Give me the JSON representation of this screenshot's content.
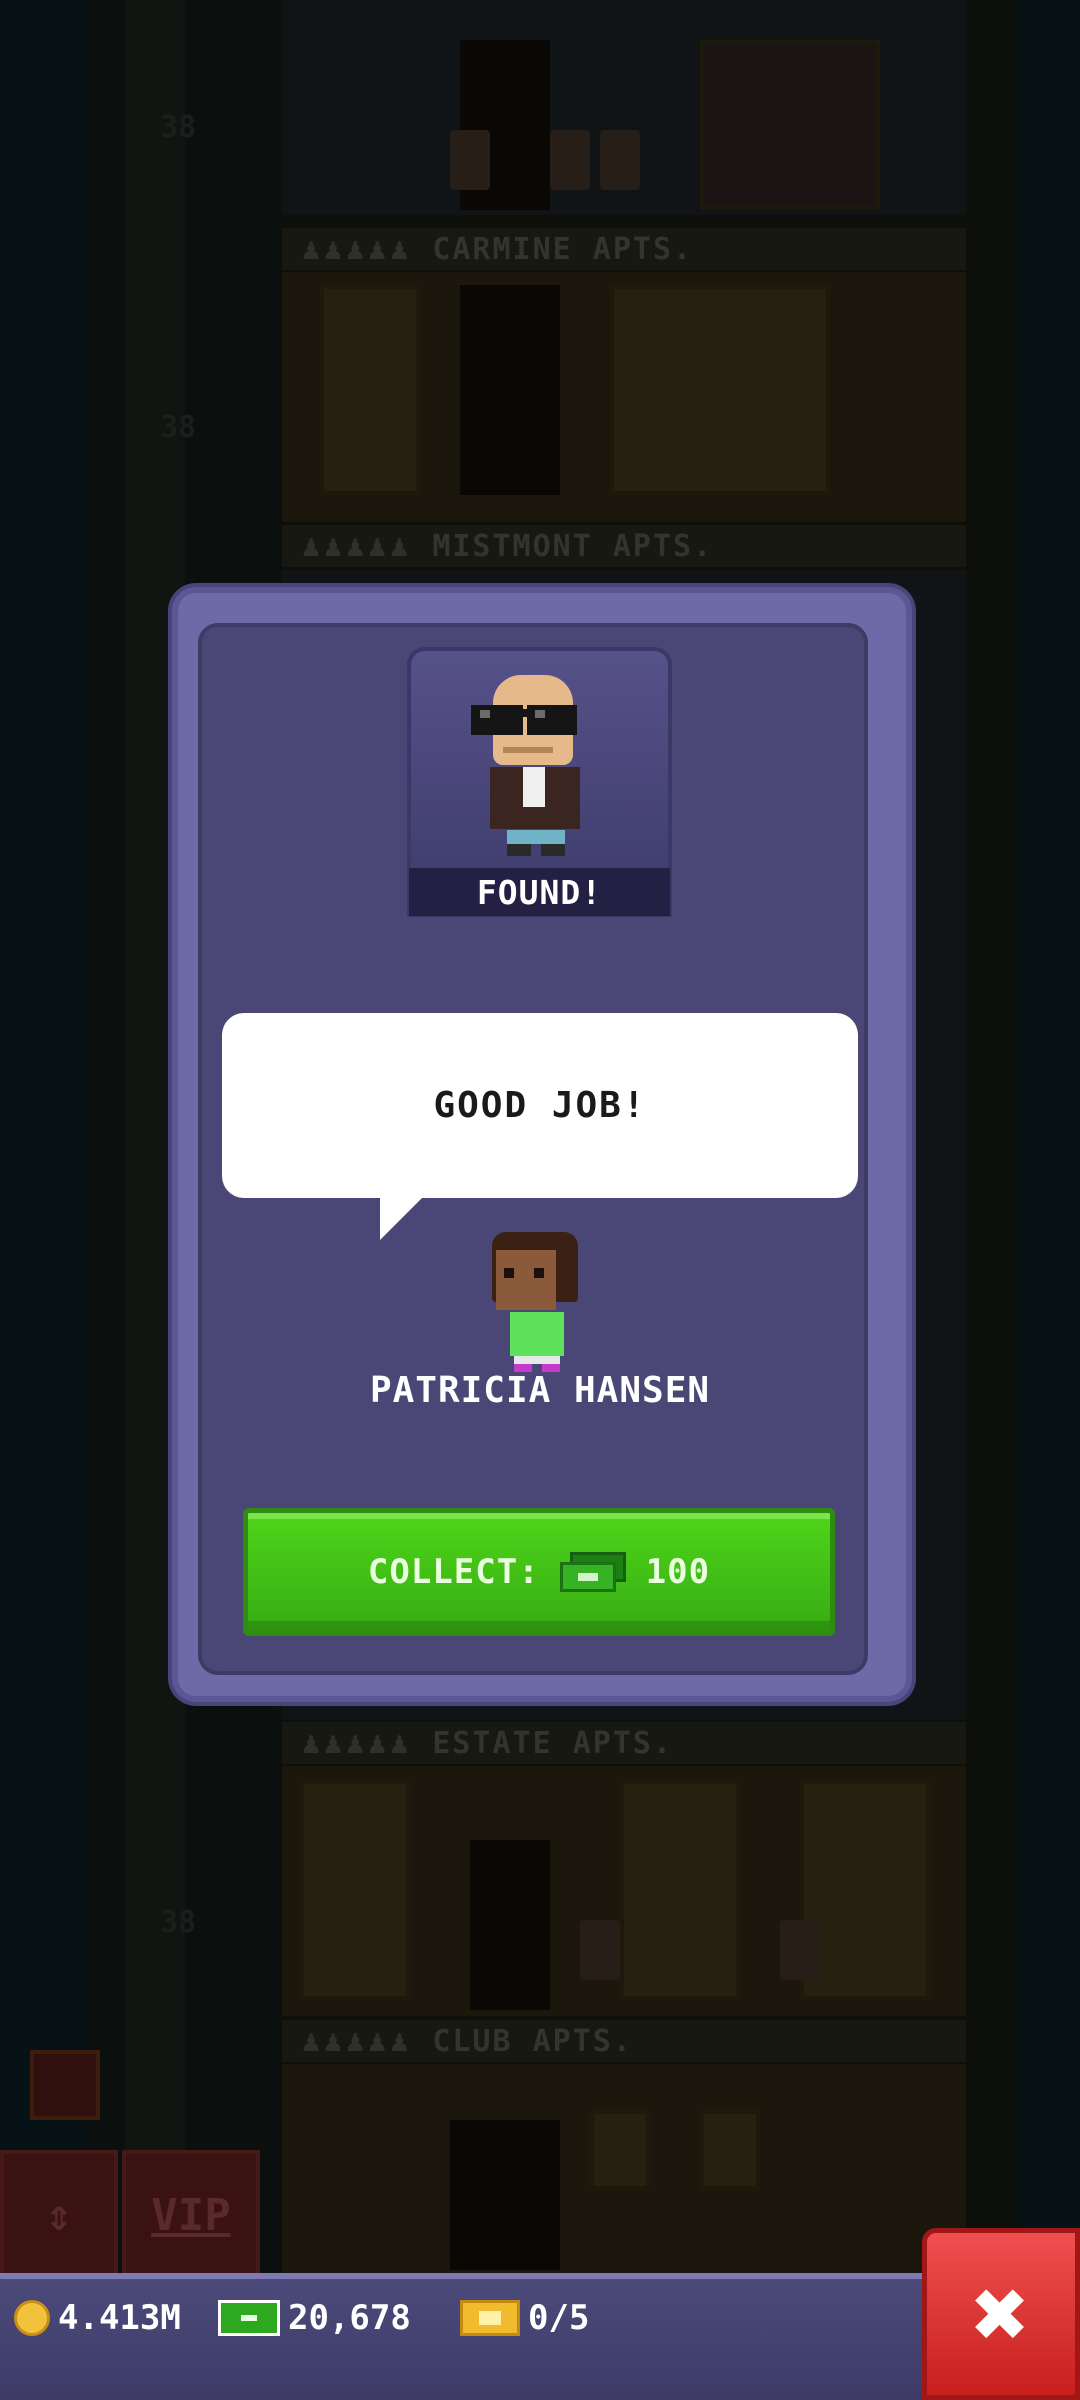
{
  "background": {
    "floors": [
      {
        "label": "CARMINE APTS.",
        "number": "38"
      },
      {
        "label": "MISTMONT APTS.",
        "number": "38"
      },
      {
        "label": "ESTATE APTS.",
        "number": "38"
      },
      {
        "label": "CLUB APTS.",
        "number": ""
      }
    ],
    "vip_label": "VIP"
  },
  "modal": {
    "found_label": "FOUND!",
    "speech_text": "GOOD JOB!",
    "speaker_name": "PATRICIA HANSEN",
    "collect_label": "COLLECT:",
    "collect_amount": "100"
  },
  "hud": {
    "coins": "4.413M",
    "bux": "20,678",
    "tickets": "0/5",
    "close_glyph": "✖"
  },
  "colors": {
    "modal_bg": "#4a4776",
    "collect_green": "#3fbf15",
    "close_red": "#e03535",
    "hud_bg": "#4c4a7a"
  }
}
